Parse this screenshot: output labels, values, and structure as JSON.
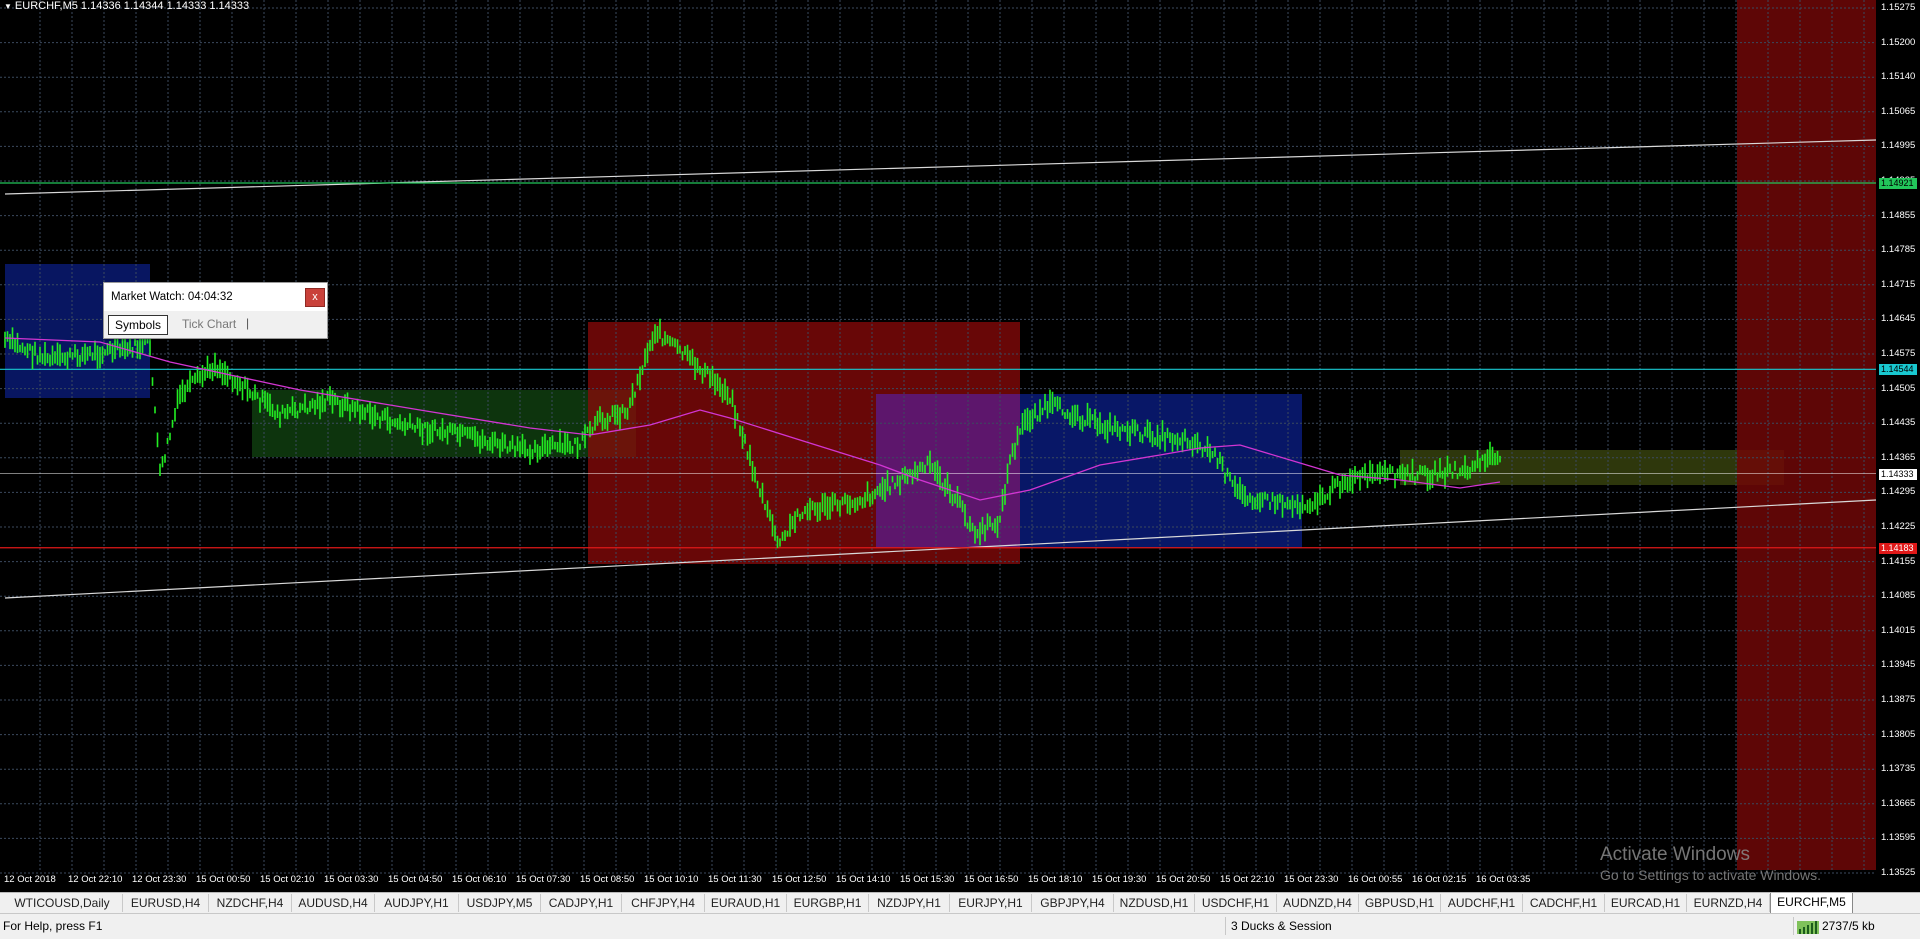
{
  "chart": {
    "title": "EURCHF,M5  1.14336 1.14344 1.14333 1.14333",
    "price_levels": [
      "1.15275",
      "1.15200",
      "1.15140",
      "1.15065",
      "1.14995",
      "1.14925",
      "1.14855",
      "1.14785",
      "1.14715",
      "1.14645",
      "1.14575",
      "1.14505",
      "1.14435",
      "1.14365",
      "1.14295",
      "1.14225",
      "1.14155",
      "1.14085",
      "1.14015",
      "1.13945",
      "1.13875",
      "1.13805",
      "1.13735",
      "1.13665",
      "1.13595",
      "1.13525"
    ],
    "price_tags": [
      {
        "label": "1.14921",
        "price": 1.14921,
        "color": "#22c55a",
        "text_color": "#000"
      },
      {
        "label": "1.14544",
        "price": 1.14544,
        "color": "#19c8d0",
        "text_color": "#000"
      },
      {
        "label": "1.14333",
        "price": 1.14333,
        "color": "#ffffff",
        "text_color": "#000"
      },
      {
        "label": "1.14183",
        "price": 1.14183,
        "color": "#e01818",
        "text_color": "#ffffff"
      }
    ],
    "time_labels": [
      "12 Oct 2018",
      "12 Oct 22:10",
      "12 Oct 23:30",
      "15 Oct 00:50",
      "15 Oct 02:10",
      "15 Oct 03:30",
      "15 Oct 04:50",
      "15 Oct 06:10",
      "15 Oct 07:30",
      "15 Oct 08:50",
      "15 Oct 10:10",
      "15 Oct 11:30",
      "15 Oct 12:50",
      "15 Oct 14:10",
      "15 Oct 15:30",
      "15 Oct 16:50",
      "15 Oct 18:10",
      "15 Oct 19:30",
      "15 Oct 20:50",
      "15 Oct 22:10",
      "15 Oct 23:30",
      "16 Oct 00:55",
      "16 Oct 02:15",
      "16 Oct 03:35"
    ],
    "colors": {
      "grid": "#3b4a5e",
      "candles": "#22ee22",
      "ma": "#d235d2",
      "trendline": "#d9d9d9"
    }
  },
  "market_watch": {
    "title": "Market Watch: 04:04:32",
    "close_label": "x",
    "tabs": [
      "Symbols",
      "Tick Chart"
    ],
    "separator": "|"
  },
  "symbol_tabs": [
    "WTICOUSD,Daily",
    "EURUSD,H4",
    "NZDCHF,H4",
    "AUDUSD,H4",
    "AUDJPY,H1",
    "USDJPY,M5",
    "CADJPY,H1",
    "CHFJPY,H4",
    "EURAUD,H1",
    "EURGBP,H1",
    "NZDJPY,H1",
    "EURJPY,H1",
    "GBPJPY,H4",
    "NZDUSD,H1",
    "USDCHF,H1",
    "AUDNZD,H4",
    "GBPUSD,H1",
    "AUDCHF,H1",
    "CADCHF,H1",
    "EURCAD,H1",
    "EURNZD,H4",
    "EURCHF,M5"
  ],
  "active_tab": "EURCHF,M5",
  "status": {
    "help": "For Help, press F1",
    "profile": "3 Ducks & Session",
    "traffic": "2737/5 kb"
  },
  "watermark": {
    "line1": "Activate Windows",
    "line2": "Go to Settings to activate Windows."
  }
}
